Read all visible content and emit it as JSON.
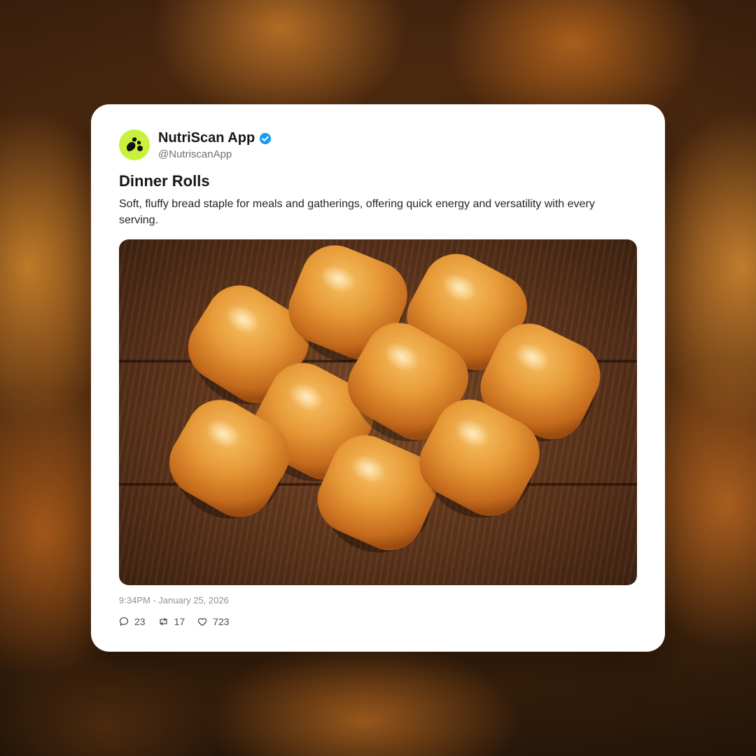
{
  "post": {
    "author_name": "NutriScan App",
    "handle": "@NutriscanApp",
    "title": "Dinner Rolls",
    "description": "Soft, fluffy bread staple for meals and gatherings, offering quick energy and versatility with every serving.",
    "timestamp": "9:34PM - January 25, 2026",
    "stats": {
      "replies": "23",
      "reposts": "17",
      "likes": "723"
    }
  },
  "colors": {
    "avatar_bg": "#c8f03c",
    "verified": "#1d9bf0"
  },
  "icons": {
    "reply": "comment-icon",
    "repost": "repost-icon",
    "like": "heart-icon",
    "verified": "verified-badge-icon"
  }
}
